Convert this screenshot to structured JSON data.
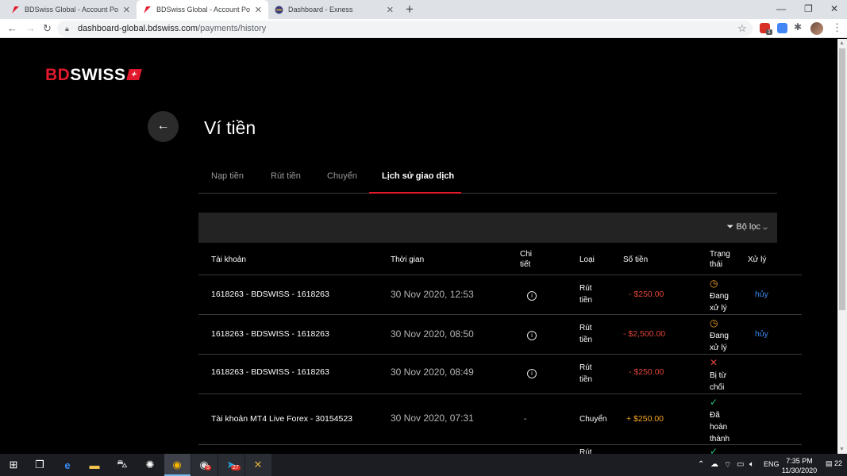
{
  "browser": {
    "tabs": [
      {
        "title": "BDSwiss Global - Account Portal"
      },
      {
        "title": "BDSwiss Global - Account Portal"
      },
      {
        "title": "Dashboard - Exness"
      }
    ],
    "url_host": "dashboard-global.bdswiss.com",
    "url_path": "/payments/history",
    "ext_badge": "1"
  },
  "app": {
    "logo_prefix": "BD",
    "logo_rest": "SWISS",
    "logo_flag": "+",
    "page_title": "Ví tiền",
    "tabs": [
      "Nạp tiền",
      "Rút tiền",
      "Chuyển",
      "Lịch sử giao dịch"
    ],
    "active_tab": "Lịch sử giao dịch",
    "filter_label": "Bộ lọc"
  },
  "table": {
    "headers": {
      "account": "Tài khoản",
      "time": "Thời gian",
      "detail_1": "Chi",
      "detail_2": "tiết",
      "type": "Loại",
      "amount": "Số tiền",
      "status_1": "Trạng",
      "status_2": "thái",
      "action": "Xử lý"
    },
    "rows": [
      {
        "account": "1618263 - BDSWISS - 1618263",
        "time": "30 Nov 2020, 12:53",
        "detail": "info",
        "type_1": "Rút",
        "type_2": "tiền",
        "amount": "- $250.00",
        "status_1": "Đang",
        "status_2": "xử lý",
        "status_3": "",
        "status_kind": "pending",
        "action": "hủy"
      },
      {
        "account": "1618263 - BDSWISS - 1618263",
        "time": "30 Nov 2020, 08:50",
        "detail": "info",
        "type_1": "Rút",
        "type_2": "tiền",
        "amount": "- $2,500.00",
        "status_1": "Đang",
        "status_2": "xử lý",
        "status_3": "",
        "status_kind": "pending",
        "action": "hủy"
      },
      {
        "account": "1618263 - BDSWISS - 1618263",
        "time": "30 Nov 2020, 08:49",
        "detail": "info",
        "type_1": "Rút",
        "type_2": "tiền",
        "amount": "- $250.00",
        "status_1": "Bị từ",
        "status_2": "chối",
        "status_3": "",
        "status_kind": "rejected",
        "action": ""
      },
      {
        "account": "Tài khoản MT4 Live Forex - 30154523",
        "time": "30 Nov 2020, 07:31",
        "detail": "-",
        "type_1": "Chuyển",
        "type_2": "",
        "amount": "+ $250.00",
        "status_1": "Đã",
        "status_2": "hoàn",
        "status_3": "thành",
        "status_kind": "done",
        "action": ""
      }
    ],
    "partial_row": {
      "type_1": "Rút"
    }
  },
  "taskbar": {
    "chrome_badge": "5",
    "telegram_badge": "27",
    "lang": "ENG",
    "time": "7:35 PM",
    "date": "11/30/2020",
    "notif_count": "22"
  },
  "colors": {
    "brand_red": "#e2192c",
    "negative": "#e2453a",
    "positive": "#f5a623",
    "pending": "#f5a623",
    "done": "#27c27e",
    "link": "#3b8bf0"
  }
}
